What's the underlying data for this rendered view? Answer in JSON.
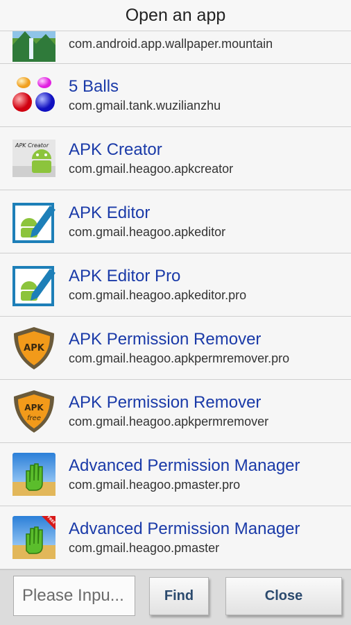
{
  "dialog": {
    "title": "Open an app"
  },
  "apps": [
    {
      "name": "",
      "package": "com.android.app.wallpaper.mountain",
      "icon": "landscape-icon"
    },
    {
      "name": "5 Balls",
      "package": "com.gmail.tank.wuzilianzhu",
      "icon": "balls-icon"
    },
    {
      "name": "APK Creator",
      "package": "com.gmail.heagoo.apkcreator",
      "icon": "apk-creator-icon"
    },
    {
      "name": "APK Editor",
      "package": "com.gmail.heagoo.apkeditor",
      "icon": "apk-editor-icon"
    },
    {
      "name": "APK Editor Pro",
      "package": "com.gmail.heagoo.apkeditor.pro",
      "icon": "apk-editor-icon"
    },
    {
      "name": "APK Permission Remover",
      "package": "com.gmail.heagoo.apkpermremover.pro",
      "icon": "apk-shield-icon"
    },
    {
      "name": "APK Permission Remover",
      "package": "com.gmail.heagoo.apkpermremover",
      "icon": "apk-shield-free-icon"
    },
    {
      "name": "Advanced Permission Manager",
      "package": "com.gmail.heagoo.pmaster.pro",
      "icon": "permission-hand-icon"
    },
    {
      "name": "Advanced Permission Manager",
      "package": "com.gmail.heagoo.pmaster",
      "icon": "permission-hand-free-icon"
    }
  ],
  "icon_text": {
    "apk_creator": "APK Creator",
    "apk": "APK",
    "free": "free",
    "free_ribbon": "FREE"
  },
  "footer": {
    "search_placeholder": "Please Inpu...",
    "find_label": "Find",
    "close_label": "Close"
  },
  "colors": {
    "app_name": "#1a3aa8",
    "package_text": "#333333",
    "button_text": "#2b4a6e"
  }
}
